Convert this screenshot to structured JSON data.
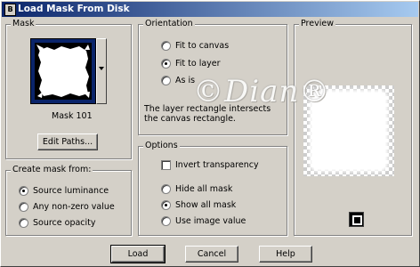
{
  "window": {
    "title": "Load Mask From Disk",
    "app_icon": "B"
  },
  "mask": {
    "legend": "Mask",
    "name": "Mask 101",
    "edit_paths": "Edit Paths..."
  },
  "create_from": {
    "legend": "Create mask from:",
    "options": [
      "Source luminance",
      "Any non-zero value",
      "Source opacity"
    ],
    "selected": 0
  },
  "orientation": {
    "legend": "Orientation",
    "options": [
      "Fit to canvas",
      "Fit to layer",
      "As is"
    ],
    "selected": 1,
    "description": "The layer rectangle intersects the canvas rectangle."
  },
  "options": {
    "legend": "Options",
    "invert_label": "Invert transparency",
    "invert_checked": false,
    "radios": [
      "Hide all mask",
      "Show all mask",
      "Use image value"
    ],
    "selected": 1
  },
  "preview": {
    "legend": "Preview",
    "watermark": "©Dian®"
  },
  "buttons": {
    "load": "Load",
    "cancel": "Cancel",
    "help": "Help"
  }
}
